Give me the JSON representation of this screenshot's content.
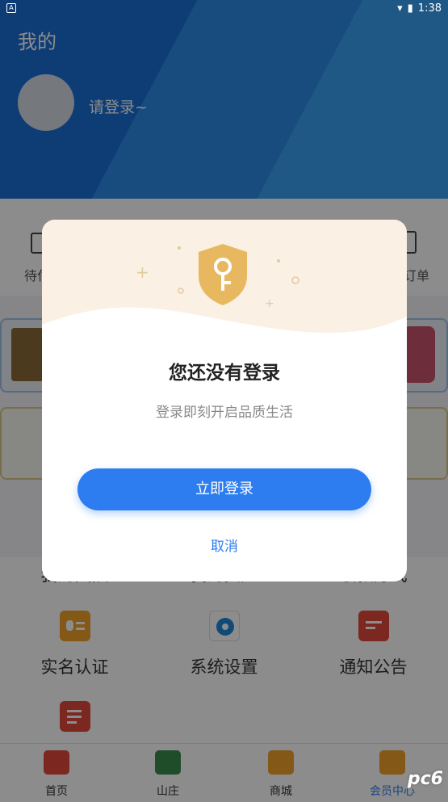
{
  "status": {
    "time": "1:38"
  },
  "header": {
    "title": "我的",
    "login_prompt": "请登录~"
  },
  "orders": {
    "left_label": "待付",
    "right_label": "订单"
  },
  "grid": [
    {
      "label": "我的团队",
      "icon": "team-icon"
    },
    {
      "label": "我的资产",
      "icon": "assets-icon"
    },
    {
      "label": "收款方式",
      "icon": "payment-icon"
    },
    {
      "label": "实名认证",
      "icon": "id-card-icon"
    },
    {
      "label": "系统设置",
      "icon": "gear-icon"
    },
    {
      "label": "通知公告",
      "icon": "message-icon"
    },
    {
      "label": "",
      "icon": "edit-icon"
    }
  ],
  "tabs": [
    {
      "label": "首页",
      "icon": "home-icon"
    },
    {
      "label": "山庄",
      "icon": "villa-icon"
    },
    {
      "label": "商城",
      "icon": "ticket-icon"
    },
    {
      "label": "会员中心",
      "icon": "member-card-icon"
    }
  ],
  "dialog": {
    "title": "您还没有登录",
    "subtitle": "登录即刻开启品质生活",
    "login_button": "立即登录",
    "cancel_button": "取消"
  },
  "watermark": "pc6",
  "colors": {
    "header_blue": "#1a6fd6",
    "accent_blue": "#2d7df0",
    "dialog_cream": "#faf1e4",
    "shield_gold": "#e8b860"
  }
}
